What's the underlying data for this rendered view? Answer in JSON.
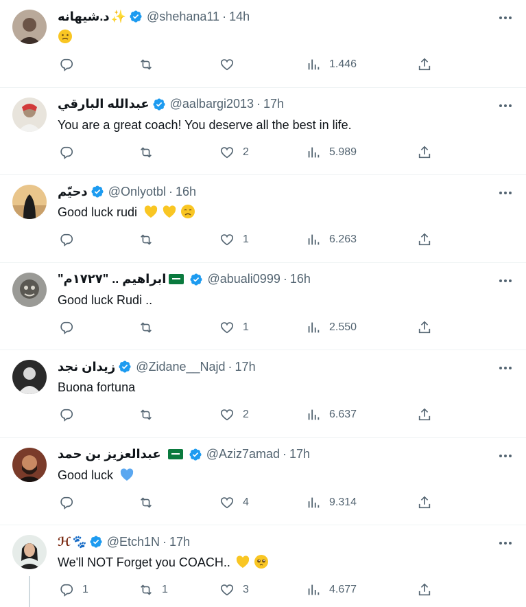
{
  "tweets": [
    {
      "display_name": "د.شيهانه",
      "name_decoration": "✨",
      "handle": "@shehana11",
      "time": "14h",
      "text": "",
      "emoji": [
        "neutral-face"
      ],
      "reply_count": "",
      "retweet_count": "",
      "like_count": "",
      "views": "1.446",
      "flag": false
    },
    {
      "display_name": "عبدالله البارقي",
      "handle": "@aalbargi2013",
      "time": "17h",
      "text": "You are a great coach! You deserve all the best in life.",
      "emoji": [],
      "reply_count": "",
      "retweet_count": "",
      "like_count": "2",
      "views": "5.989",
      "flag": false
    },
    {
      "display_name": "دحيّم",
      "handle": "@Onlyotbl",
      "time": "16h",
      "text": "Good luck rudi",
      "emoji": [
        "yellow-heart",
        "yellow-heart",
        "sad-face"
      ],
      "reply_count": "",
      "retweet_count": "",
      "like_count": "1",
      "views": "6.263",
      "flag": false
    },
    {
      "display_name": "\"ابراهيم .. \"١٧٢٧م",
      "handle": "@abuali0999",
      "time": "16h",
      "text": "Good luck Rudi ..",
      "emoji": [],
      "reply_count": "",
      "retweet_count": "",
      "like_count": "1",
      "views": "2.550",
      "flag": true
    },
    {
      "display_name": "زيدان نجد",
      "handle": "@Zidane__Najd",
      "time": "17h",
      "text": "Buona fortuna",
      "emoji": [],
      "reply_count": "",
      "retweet_count": "",
      "like_count": "2",
      "views": "6.637",
      "flag": false
    },
    {
      "display_name": "عبدالعزيز بن حمد",
      "handle": "@Aziz7amad",
      "time": "17h",
      "text": "Good luck",
      "emoji": [
        "blue-heart"
      ],
      "reply_count": "",
      "retweet_count": "",
      "like_count": "4",
      "views": "9.314",
      "flag": true
    },
    {
      "display_name": "ℋ🐾",
      "handle": "@Etch1N",
      "time": "17h",
      "text": "We'll NOT Forget you COACH..",
      "emoji": [
        "yellow-heart",
        "pleading-face"
      ],
      "reply_count": "1",
      "retweet_count": "1",
      "like_count": "3",
      "views": "4.677",
      "flag": false
    }
  ],
  "colors": {
    "verified": "#1d9bf0",
    "muted": "#536471",
    "text": "#0f1419",
    "divider": "#eff3f4",
    "yellow_heart": "#f9c623",
    "blue_heart": "#5aa7f0"
  },
  "icons": [
    "reply-icon",
    "retweet-icon",
    "like-icon",
    "views-icon",
    "share-icon",
    "more-icon",
    "verified-badge-icon",
    "saudi-flag-icon"
  ]
}
